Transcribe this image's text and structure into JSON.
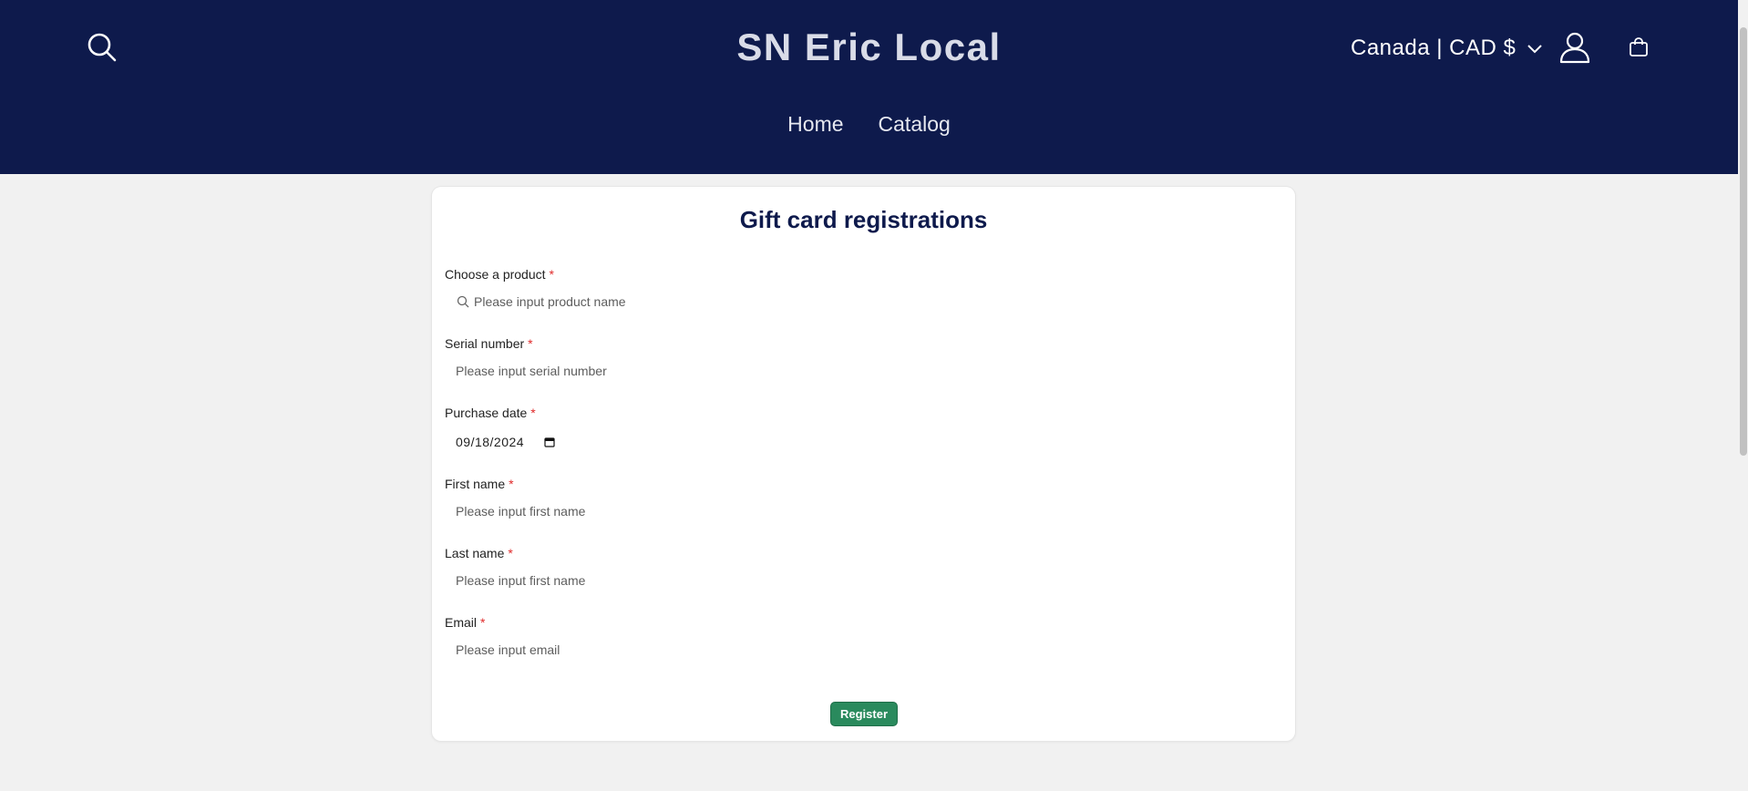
{
  "header": {
    "site_title": "SN Eric Local",
    "locale_label": "Canada | CAD $",
    "nav": [
      {
        "label": "Home"
      },
      {
        "label": "Catalog"
      }
    ]
  },
  "form": {
    "title": "Gift card registrations",
    "required_marker": "*",
    "fields": {
      "product": {
        "label": "Choose a product",
        "placeholder": "Please input product name"
      },
      "serial": {
        "label": "Serial number",
        "placeholder": "Please input serial number"
      },
      "purchase_date": {
        "label": "Purchase date",
        "value": "09/18/2024"
      },
      "first_name": {
        "label": "First name",
        "placeholder": "Please input first name"
      },
      "last_name": {
        "label": "Last name",
        "placeholder": "Please input first name"
      },
      "email": {
        "label": "Email",
        "placeholder": "Please input email"
      }
    },
    "submit_label": "Register"
  },
  "colors": {
    "header_bg": "#0e1a4c",
    "page_bg": "#f1f1f1",
    "accent_green": "#2a8a5d",
    "required_red": "#e02a2a"
  },
  "icons": [
    "search-icon",
    "chevron-down-icon",
    "account-icon",
    "cart-icon",
    "calendar-icon"
  ]
}
